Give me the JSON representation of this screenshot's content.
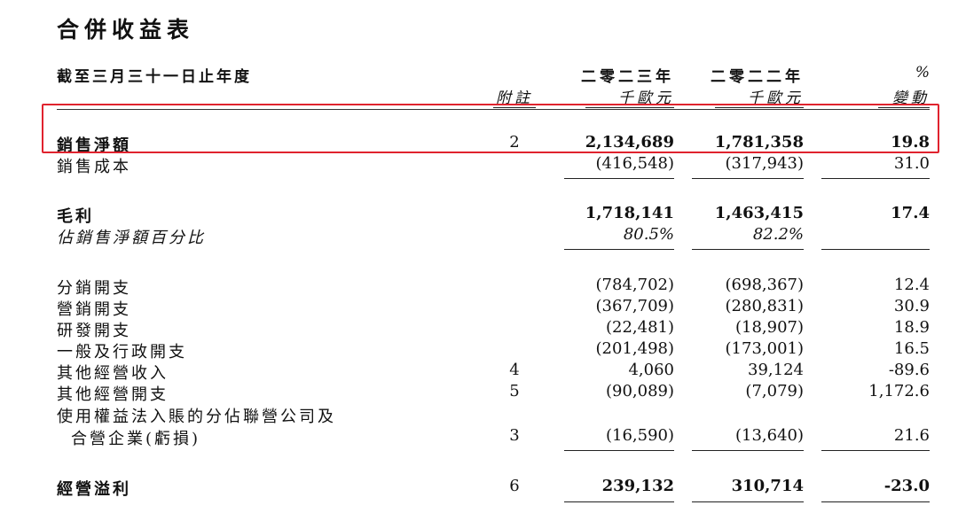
{
  "title": "合併收益表",
  "period": "截至三月三十一日止年度",
  "columns": {
    "note": "附註",
    "y2023": "二零二三年",
    "y2022": "二零二二年",
    "change_pct": "%",
    "unit": "千歐元",
    "change": "變動"
  },
  "rows": [
    {
      "label": "銷售淨額",
      "note": "2",
      "v2023": "2,134,689",
      "v2022": "1,781,358",
      "change": "19.8"
    },
    {
      "label": "銷售成本",
      "note": "",
      "v2023": "(416,548)",
      "v2022": "(317,943)",
      "change": "31.0"
    },
    {
      "label": "毛利",
      "note": "",
      "v2023": "1,718,141",
      "v2022": "1,463,415",
      "change": "17.4"
    },
    {
      "label": "佔銷售淨額百分比",
      "note": "",
      "v2023": "80.5%",
      "v2022": "82.2%",
      "change": ""
    },
    {
      "label": "分銷開支",
      "note": "",
      "v2023": "(784,702)",
      "v2022": "(698,367)",
      "change": "12.4"
    },
    {
      "label": "營銷開支",
      "note": "",
      "v2023": "(367,709)",
      "v2022": "(280,831)",
      "change": "30.9"
    },
    {
      "label": "研發開支",
      "note": "",
      "v2023": "(22,481)",
      "v2022": "(18,907)",
      "change": "18.9"
    },
    {
      "label": "一般及行政開支",
      "note": "",
      "v2023": "(201,498)",
      "v2022": "(173,001)",
      "change": "16.5"
    },
    {
      "label": "其他經營收入",
      "note": "4",
      "v2023": "4,060",
      "v2022": "39,124",
      "change": "-89.6"
    },
    {
      "label": "其他經營開支",
      "note": "5",
      "v2023": "(90,089)",
      "v2022": "(7,079)",
      "change": "1,172.6"
    },
    {
      "label": "使用權益法入賬的分佔聯營公司及",
      "note": "",
      "v2023": "",
      "v2022": "",
      "change": ""
    },
    {
      "label": "合營企業(虧損)",
      "note": "3",
      "v2023": "(16,590)",
      "v2022": "(13,640)",
      "change": "21.6"
    },
    {
      "label": "經營溢利",
      "note": "6",
      "v2023": "239,132",
      "v2022": "310,714",
      "change": "-23.0"
    }
  ]
}
